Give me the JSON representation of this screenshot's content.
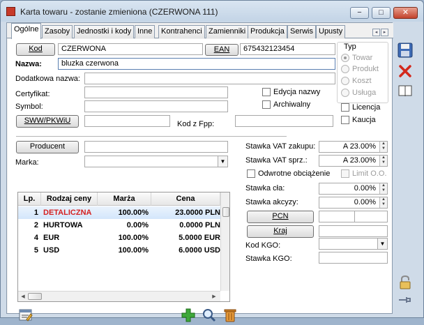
{
  "window": {
    "title": "Karta towaru - zostanie zmieniona (CZERWONA 111)",
    "controls": {
      "minimize": "−",
      "maximize": "□",
      "close": "✕"
    }
  },
  "tabs": [
    "Ogólne",
    "Zasoby",
    "Jednostki i kody",
    "Inne",
    "Kontrahenci",
    "Zamienniki",
    "Produkcja",
    "Serwis",
    "Upusty"
  ],
  "tab_arrows": {
    "left": "◂",
    "right": "▸"
  },
  "form": {
    "kod_button": "Kod",
    "kod_value": "CZERWONA",
    "ean_button": "EAN",
    "ean_value": "675432123454",
    "nazwa_label": "Nazwa:",
    "nazwa_value": "bluzka czerwona",
    "dodatkowa_label": "Dodatkowa nazwa:",
    "dodatkowa_value": "",
    "certyfikat_label": "Certyfikat:",
    "certyfikat_value": "",
    "symbol_label": "Symbol:",
    "symbol_value": "",
    "sww_button": "SWW/PKWiU",
    "sww_value": "",
    "kod_fpp_label": "Kod z Fpp:",
    "kod_fpp_value": "",
    "edycja_nazwy_label": "Edycja nazwy",
    "archiwalny_label": "Archiwalny",
    "licencja_label": "Licencja",
    "kaucja_label": "Kaucja",
    "typ_label": "Typ",
    "typ_options": [
      "Towar",
      "Produkt",
      "Koszt",
      "Usługa"
    ],
    "typ_selected": "Towar",
    "producent_button": "Producent",
    "producent_value": "",
    "marka_label": "Marka:",
    "marka_value": ""
  },
  "prices": {
    "columns": [
      "Lp.",
      "Rodzaj ceny",
      "Marża",
      "Cena"
    ],
    "rows": [
      {
        "lp": "1",
        "rodzaj": "DETALICZNA",
        "marza": "100.00%",
        "cena": "23.0000 PLN",
        "color": "#d42020"
      },
      {
        "lp": "2",
        "rodzaj": "HURTOWA",
        "marza": "0.00%",
        "cena": "0.0000 PLN",
        "color": "#000000"
      },
      {
        "lp": "4",
        "rodzaj": "EUR",
        "marza": "100.00%",
        "cena": "5.0000 EUR",
        "color": "#000000"
      },
      {
        "lp": "5",
        "rodzaj": "USD",
        "marza": "100.00%",
        "cena": "6.0000 USD",
        "color": "#000000"
      }
    ]
  },
  "vat": {
    "zakupu_label": "Stawka VAT zakupu:",
    "zakupu_value": "A 23.00%",
    "sprz_label": "Stawka VAT sprz.:",
    "sprz_value": "A 23.00%",
    "odwrotne_label": "Odwrotne obciążenie",
    "limit_label": "Limit O.O.",
    "cla_label": "Stawka cła:",
    "cla_value": "0.00%",
    "akcyzy_label": "Stawka akcyzy:",
    "akcyzy_value": "0.00%",
    "pcn_button": "PCN",
    "kraj_button": "Kraj",
    "kgo_label": "Kod KGO:",
    "kgo_value": "",
    "stawka_kgo_label": "Stawka KGO:",
    "stawka_kgo_value": ""
  },
  "colors": {
    "accent": "#3a6ea5",
    "title_bar": "#c3d4e6",
    "selected_row": "#d3e6fb",
    "red_text": "#d42020"
  }
}
